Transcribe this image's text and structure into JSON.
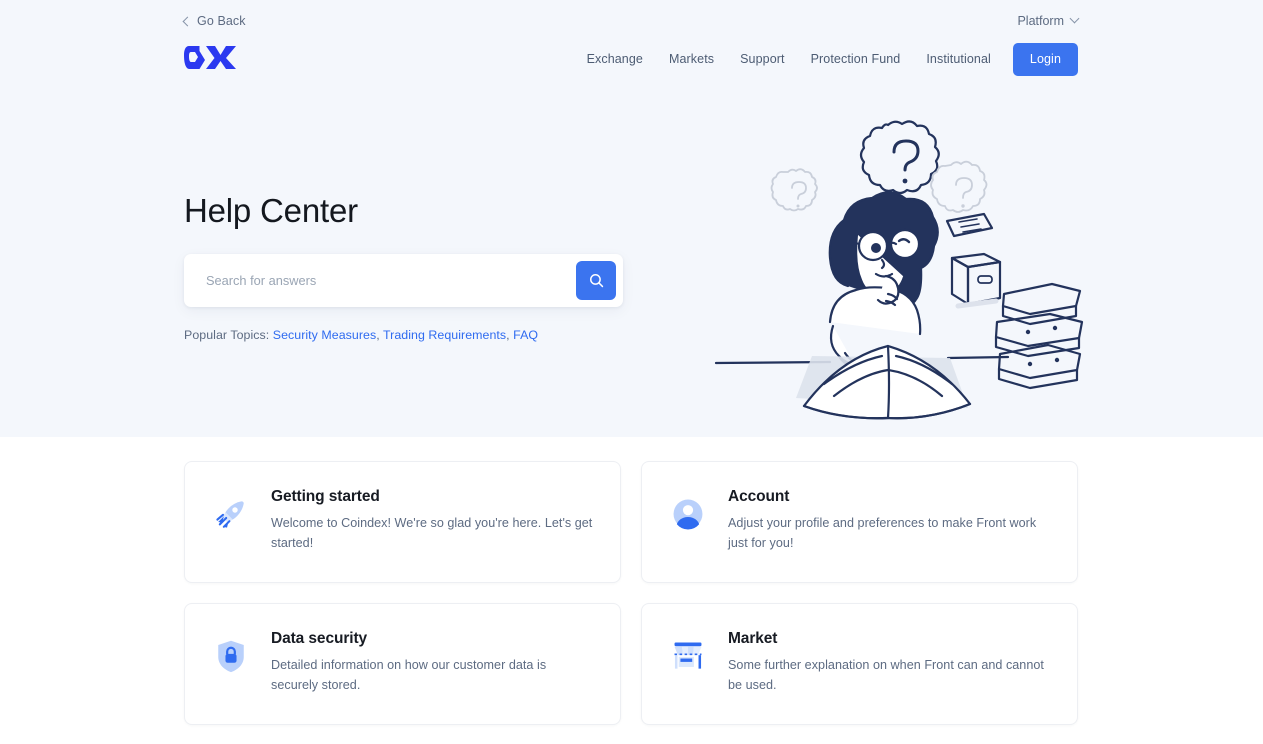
{
  "topbar": {
    "go_back": "Go Back",
    "go_back_icon": "chevron-left-icon",
    "platform": "Platform",
    "platform_icon": "chevron-down-icon"
  },
  "header": {
    "logo_alt": "CX",
    "nav": [
      {
        "label": "Exchange"
      },
      {
        "label": "Markets"
      },
      {
        "label": "Support"
      },
      {
        "label": "Protection Fund"
      },
      {
        "label": "Institutional"
      }
    ],
    "login_label": "Login"
  },
  "hero": {
    "title": "Help Center",
    "search": {
      "value": "",
      "placeholder": "Search for answers",
      "button_icon": "search-icon"
    },
    "popular_topics_label": "Popular Topics:",
    "popular_topics": [
      {
        "label": "Security Measures"
      },
      {
        "label": "Trading Requirements"
      },
      {
        "label": "FAQ"
      }
    ],
    "separator": ",",
    "illustration_alt": "woman reading a book with question marks, papers, box and stack of books"
  },
  "cards": [
    {
      "icon": "rocket-icon",
      "title": "Getting started",
      "description": "Welcome to Coindex! We're so glad you're here. Let's get started!"
    },
    {
      "icon": "account-avatar-icon",
      "title": "Account",
      "description": "Adjust your profile and preferences to make Front work just for you!"
    },
    {
      "icon": "shield-lock-icon",
      "title": "Data security",
      "description": "Detailed information on how our customer data is securely stored."
    },
    {
      "icon": "storefront-icon",
      "title": "Market",
      "description": "Some further explanation on when Front can and cannot be used."
    }
  ],
  "colors": {
    "brand_blue": "#2b39f0",
    "accent_blue": "#3b74ef",
    "link_blue": "#2f6bf0",
    "hero_background": "#f4f7fc",
    "page_background": "#ffffff",
    "heading_text": "#14181f",
    "body_text": "#5d6b82",
    "illustration_ink": "#23335c",
    "icon_light_blue": "#b9d0fb"
  }
}
